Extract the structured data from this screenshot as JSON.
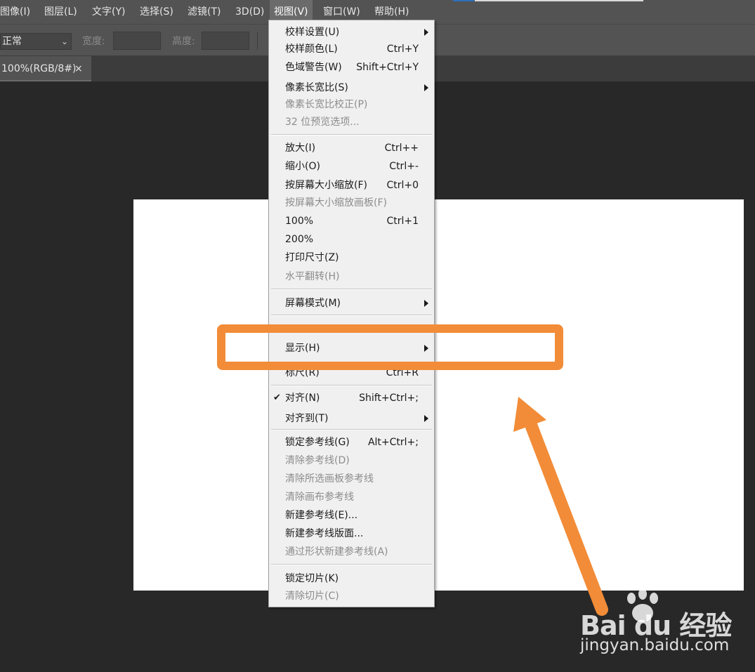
{
  "menubar": {
    "items": [
      "图像(I)",
      "图层(L)",
      "文字(Y)",
      "选择(S)",
      "滤镜(T)",
      "3D(D)",
      "视图(V)",
      "窗口(W)",
      "帮助(H)"
    ],
    "active": "视图(V)"
  },
  "options": {
    "mode_value": "正常",
    "width_label": "宽度:",
    "height_label": "高度:"
  },
  "tab": {
    "label": "100%(RGB/8#)",
    "close": "×"
  },
  "view_menu": {
    "items": [
      {
        "label": "校样设置(U)",
        "shortcut": "",
        "submenu": true,
        "disabled": false
      },
      {
        "label": "校样颜色(L)",
        "shortcut": "Ctrl+Y",
        "disabled": false
      },
      {
        "label": "色域警告(W)",
        "shortcut": "Shift+Ctrl+Y",
        "disabled": false
      },
      {
        "label": "像素长宽比(S)",
        "shortcut": "",
        "submenu": true,
        "disabled": false
      },
      {
        "label": "像素长宽比校正(P)",
        "shortcut": "",
        "disabled": true
      },
      {
        "label": "32 位预览选项...",
        "shortcut": "",
        "disabled": true
      },
      {
        "label": "放大(I)",
        "shortcut": "Ctrl++",
        "disabled": false
      },
      {
        "label": "缩小(O)",
        "shortcut": "Ctrl+-",
        "disabled": false
      },
      {
        "label": "按屏幕大小缩放(F)",
        "shortcut": "Ctrl+0",
        "disabled": false
      },
      {
        "label": "按屏幕大小缩放画板(F)",
        "shortcut": "",
        "disabled": true
      },
      {
        "label": "100%",
        "shortcut": "Ctrl+1",
        "disabled": false
      },
      {
        "label": "200%",
        "shortcut": "",
        "disabled": false
      },
      {
        "label": "打印尺寸(Z)",
        "shortcut": "",
        "disabled": false
      },
      {
        "label": "水平翻转(H)",
        "shortcut": "",
        "disabled": true
      },
      {
        "label": "屏幕模式(M)",
        "shortcut": "",
        "submenu": true,
        "disabled": false
      },
      {
        "label": "显示(H)",
        "shortcut": "",
        "submenu": true,
        "disabled": false
      },
      {
        "label": "标尺(R)",
        "shortcut": "Ctrl+R",
        "disabled": false
      },
      {
        "label": "对齐(N)",
        "shortcut": "Shift+Ctrl+;",
        "checked": true,
        "disabled": false
      },
      {
        "label": "对齐到(T)",
        "shortcut": "",
        "submenu": true,
        "disabled": false
      },
      {
        "label": "锁定参考线(G)",
        "shortcut": "Alt+Ctrl+;",
        "disabled": false
      },
      {
        "label": "清除参考线(D)",
        "shortcut": "",
        "disabled": true
      },
      {
        "label": "清除所选画板参考线",
        "shortcut": "",
        "disabled": true
      },
      {
        "label": "清除画布参考线",
        "shortcut": "",
        "disabled": true
      },
      {
        "label": "新建参考线(E)...",
        "shortcut": "",
        "disabled": false
      },
      {
        "label": "新建参考线版面...",
        "shortcut": "",
        "disabled": false
      },
      {
        "label": "通过形状新建参考线(A)",
        "shortcut": "",
        "disabled": true
      },
      {
        "label": "锁定切片(K)",
        "shortcut": "",
        "disabled": false
      },
      {
        "label": "清除切片(C)",
        "shortcut": "",
        "disabled": true
      }
    ],
    "check_mark": "✔"
  },
  "annotation": {
    "color": "#f28c38",
    "highlighted_item": "显示(H)"
  },
  "watermark": {
    "logo": "Bai  du 经验",
    "url": "jingyan.baidu.com"
  }
}
